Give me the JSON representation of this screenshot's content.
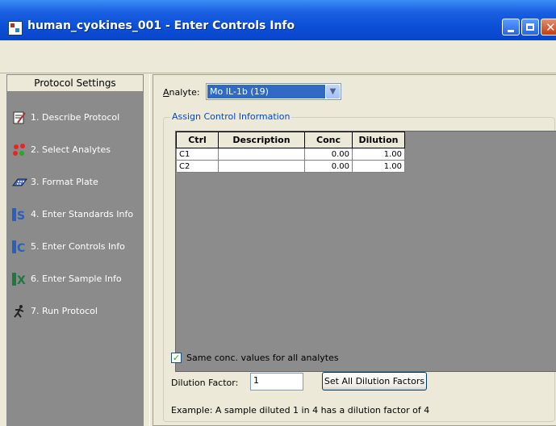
{
  "window": {
    "title": "human_cyokines_001 - Enter Controls Info"
  },
  "sidebar": {
    "header": "Protocol Settings",
    "items": [
      {
        "label": "1. Describe Protocol",
        "icon": "notepad-icon"
      },
      {
        "label": "2. Select Analytes",
        "icon": "molecules-icon"
      },
      {
        "label": "3. Format Plate",
        "icon": "plate-icon"
      },
      {
        "label": "4. Enter Standards Info",
        "icon": "standards-icon"
      },
      {
        "label": "5. Enter Controls Info",
        "icon": "controls-icon"
      },
      {
        "label": "6. Enter Sample Info",
        "icon": "samples-icon"
      },
      {
        "label": "7. Run Protocol",
        "icon": "runner-icon"
      }
    ]
  },
  "main": {
    "analyte_label": "Analyte:",
    "analyte_value": "Mo IL-1b (19)",
    "group_title": "Assign Control Information",
    "table": {
      "headers": [
        "Ctrl",
        "Description",
        "Conc",
        "Dilution"
      ],
      "rows": [
        [
          "C1",
          "",
          "0.00",
          "1.00"
        ],
        [
          "C2",
          "",
          "0.00",
          "1.00"
        ]
      ]
    },
    "same_conc_label": "Same conc. values for all analytes",
    "same_conc_checked": true,
    "dilution_label": "Dilution Factor:",
    "dilution_value": "1",
    "set_all_button": "Set All Dilution Factors",
    "example_text": "Example: A sample diluted 1 in 4 has a dilution factor of 4"
  }
}
